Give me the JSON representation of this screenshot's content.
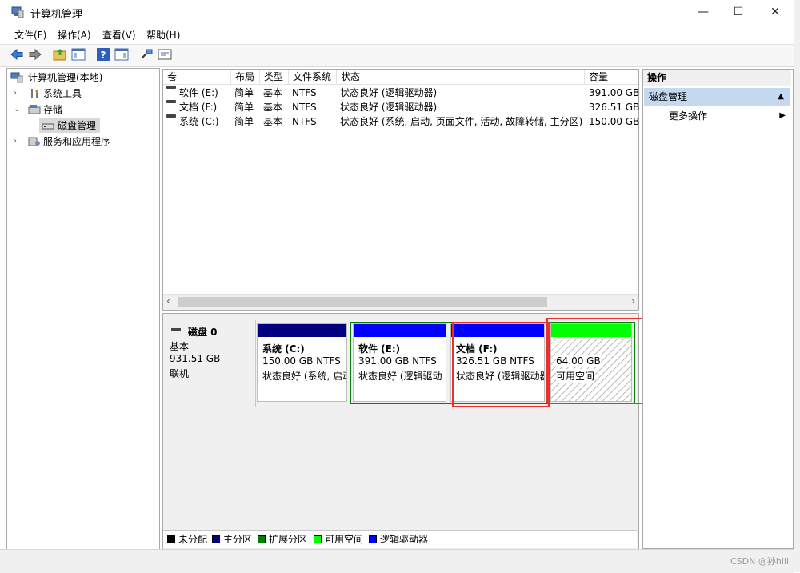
{
  "window": {
    "title": "计算机管理",
    "minimize_glyph": "—",
    "maximize_glyph": "☐",
    "close_glyph": "✕"
  },
  "menu": {
    "items": [
      "文件(F)",
      "操作(A)",
      "查看(V)",
      "帮助(H)"
    ]
  },
  "toolbar": {
    "icons": [
      "back-arrow-icon",
      "forward-arrow-icon",
      "up-folder-icon",
      "show-hide-tree-icon",
      "help-icon",
      "action-pane-icon",
      "connect-icon",
      "properties-icon"
    ]
  },
  "tree": {
    "root": "计算机管理(本地)",
    "items": [
      {
        "label": "系统工具",
        "expander": "›"
      },
      {
        "label": "存储",
        "expander": "⌄"
      },
      {
        "label": "磁盘管理",
        "expander": ""
      },
      {
        "label": "服务和应用程序",
        "expander": "›"
      }
    ]
  },
  "volumes": {
    "columns": [
      "卷",
      "布局",
      "类型",
      "文件系统",
      "状态",
      "容量"
    ],
    "rows": [
      [
        "软件 (E:)",
        "简单",
        "基本",
        "NTFS",
        "状态良好 (逻辑驱动器)",
        "391.00 GB"
      ],
      [
        "文档 (F:)",
        "简单",
        "基本",
        "NTFS",
        "状态良好 (逻辑驱动器)",
        "326.51 GB"
      ],
      [
        "系统 (C:)",
        "简单",
        "基本",
        "NTFS",
        "状态良好 (系统, 启动, 页面文件, 活动, 故障转储, 主分区)",
        "150.00 GB"
      ]
    ],
    "scroll_left": "‹",
    "scroll_right": "›"
  },
  "disk": {
    "name": "磁盘 0",
    "type": "基本",
    "size": "931.51 GB",
    "status": "联机",
    "partitions": [
      {
        "title": "系统  (C:)",
        "size": "150.00 GB NTFS",
        "status": "状态良好 (系统, 启动",
        "color": "#000080"
      },
      {
        "title": "软件  (E:)",
        "size": "391.00 GB NTFS",
        "status": "状态良好 (逻辑驱动",
        "color": "#0000ff"
      },
      {
        "title": "文档  (F:)",
        "size": "326.51 GB NTFS",
        "status": "状态良好 (逻辑驱动器",
        "color": "#0000ff"
      },
      {
        "title": "",
        "size": "64.00 GB",
        "status": "可用空间",
        "color": "#00ff00"
      }
    ]
  },
  "legend": [
    {
      "label": "未分配",
      "color": "#000000"
    },
    {
      "label": "主分区",
      "color": "#000080"
    },
    {
      "label": "扩展分区",
      "color": "#008000"
    },
    {
      "label": "可用空间",
      "color": "#00ff00"
    },
    {
      "label": "逻辑驱动器",
      "color": "#0000ff"
    }
  ],
  "actions": {
    "title": "操作",
    "section": "磁盘管理",
    "section_arrow": "▲",
    "more": "更多操作",
    "more_arrow": "▶"
  },
  "watermark": "CSDN @孙hill",
  "colors": {
    "annotation_red": "#e8302f",
    "extended_green": "#0a7d0a",
    "selection_blue": "#c4d8ef"
  }
}
